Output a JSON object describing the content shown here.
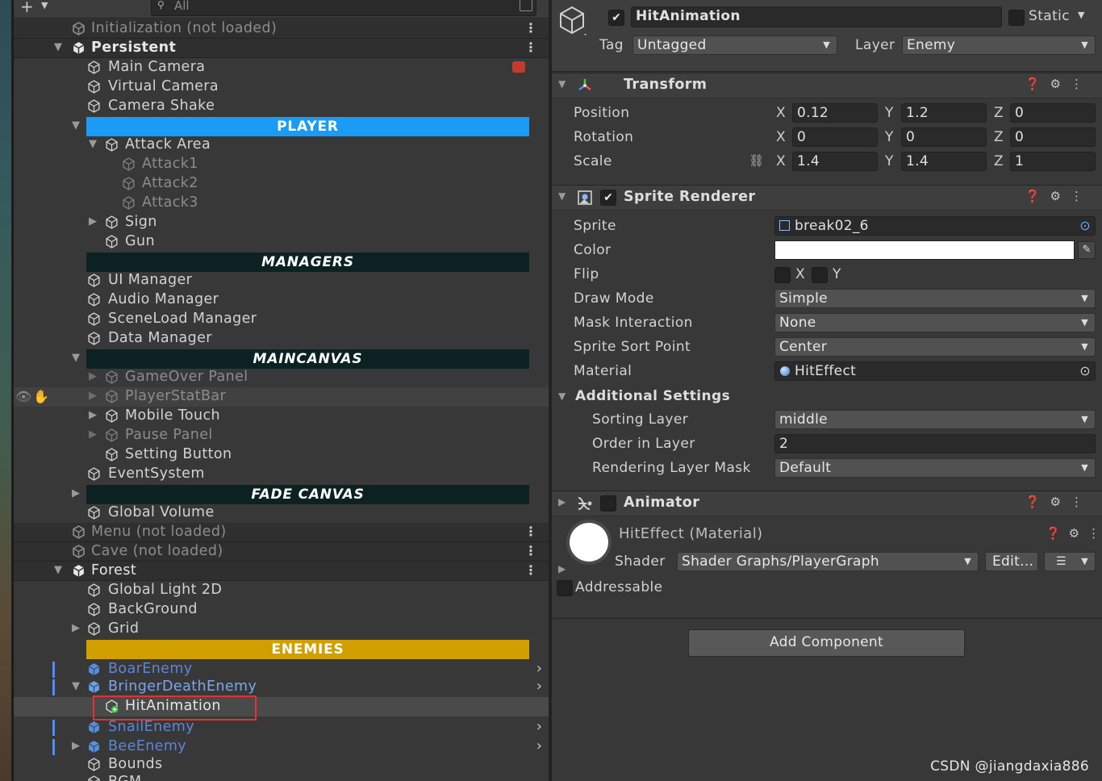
{
  "hierarchy": {
    "search_placeholder": "All",
    "add_button": "+",
    "rows": [
      {
        "label": "Initialization (not loaded)",
        "type": "scene"
      },
      {
        "label": "Persistent",
        "type": "scene"
      },
      {
        "label": "Main Camera"
      },
      {
        "label": "Virtual Camera"
      },
      {
        "label": "Camera Shake"
      },
      {
        "label": "PLAYER",
        "type": "bar"
      },
      {
        "label": "Attack Area"
      },
      {
        "label": "Attack1"
      },
      {
        "label": "Attack2"
      },
      {
        "label": "Attack3"
      },
      {
        "label": "Sign"
      },
      {
        "label": "Gun"
      },
      {
        "label": "MANAGERS",
        "type": "bar"
      },
      {
        "label": "UI Manager"
      },
      {
        "label": "Audio Manager"
      },
      {
        "label": "SceneLoad Manager"
      },
      {
        "label": "Data Manager"
      },
      {
        "label": "MAINCANVAS",
        "type": "bar"
      },
      {
        "label": "GameOver Panel"
      },
      {
        "label": "PlayerStatBar"
      },
      {
        "label": "Mobile Touch"
      },
      {
        "label": "Pause Panel"
      },
      {
        "label": "Setting Button"
      },
      {
        "label": "EventSystem"
      },
      {
        "label": "FADE CANVAS",
        "type": "bar"
      },
      {
        "label": "Global Volume"
      },
      {
        "label": "Menu (not loaded)",
        "type": "scene"
      },
      {
        "label": "Cave (not loaded)",
        "type": "scene"
      },
      {
        "label": "Forest",
        "type": "scene"
      },
      {
        "label": "Global Light 2D"
      },
      {
        "label": "BackGround"
      },
      {
        "label": "Grid"
      },
      {
        "label": "ENEMIES",
        "type": "bar"
      },
      {
        "label": "BoarEnemy"
      },
      {
        "label": "BringerDeathEnemy"
      },
      {
        "label": "HitAnimation",
        "selected": true
      },
      {
        "label": "SnailEnemy"
      },
      {
        "label": "BeeEnemy"
      },
      {
        "label": "Bounds"
      },
      {
        "label": "BGM"
      }
    ]
  },
  "inspector": {
    "object_name": "HitAnimation",
    "active": true,
    "static_label": "Static",
    "tag_label": "Tag",
    "tag_value": "Untagged",
    "layer_label": "Layer",
    "layer_value": "Enemy",
    "transform": {
      "title": "Transform",
      "position_label": "Position",
      "rotation_label": "Rotation",
      "scale_label": "Scale",
      "axis_x": "X",
      "axis_y": "Y",
      "axis_z": "Z",
      "position": {
        "x": "0.12",
        "y": "1.2",
        "z": "0"
      },
      "rotation": {
        "x": "0",
        "y": "0",
        "z": "0"
      },
      "scale": {
        "x": "1.4",
        "y": "1.4",
        "z": "1"
      }
    },
    "sprite_renderer": {
      "title": "Sprite Renderer",
      "enabled": true,
      "sprite_label": "Sprite",
      "sprite_value": "break02_6",
      "color_label": "Color",
      "color_value": "#ffffff",
      "flip_label": "Flip",
      "flip_x": "X",
      "flip_y": "Y",
      "draw_mode_label": "Draw Mode",
      "draw_mode_value": "Simple",
      "mask_label": "Mask Interaction",
      "mask_value": "None",
      "sort_point_label": "Sprite Sort Point",
      "sort_point_value": "Center",
      "material_label": "Material",
      "material_value": "HitEffect",
      "additional_label": "Additional Settings",
      "sorting_layer_label": "Sorting Layer",
      "sorting_layer_value": "middle",
      "order_label": "Order in Layer",
      "order_value": "2",
      "rlm_label": "Rendering Layer Mask",
      "rlm_value": "Default"
    },
    "animator": {
      "title": "Animator",
      "enabled": false
    },
    "material_section": {
      "title": "HitEffect (Material)",
      "shader_label": "Shader",
      "shader_value": "Shader Graphs/PlayerGraph",
      "edit_button": "Edit...",
      "addressable_label": "Addressable"
    },
    "add_component": "Add Component"
  },
  "watermark": "CSDN @jiangdaxia886"
}
